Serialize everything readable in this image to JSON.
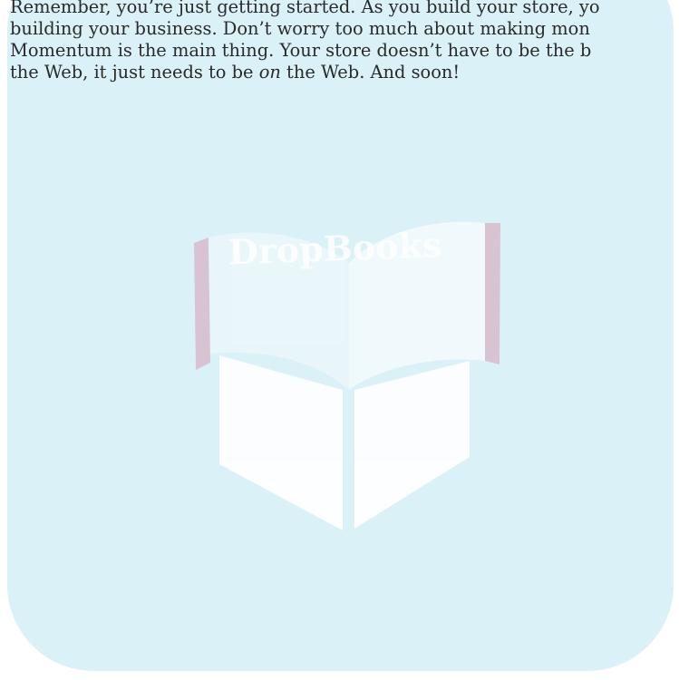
{
  "paragraph": {
    "line1": "Remember, you’re just getting started. As you build your store, yo",
    "line2": "building your business. Don’t worry too much about making mon",
    "line3": "Momentum is the main thing. Your store doesn’t have to be the b",
    "line4_before": "the Web, it just needs to be ",
    "line4_emphasis": "on",
    "line4_after": " the Web. And soon!"
  },
  "watermark": {
    "text": "DropBooks",
    "background_color": "#d9f1f7",
    "book_cover_color": "#d8bfcf",
    "book_page_color": "#ffffff"
  }
}
